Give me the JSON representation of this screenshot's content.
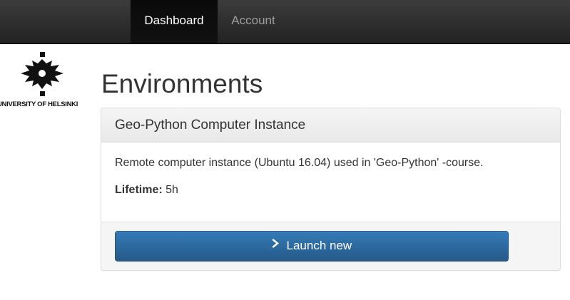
{
  "navbar": {
    "items": [
      {
        "label": "Dashboard",
        "active": true
      },
      {
        "label": "Account",
        "active": false
      }
    ]
  },
  "logo": {
    "text": "UNIVERSITY OF HELSINKI",
    "icon": "helsinki-torch-logo"
  },
  "page": {
    "title": "Environments"
  },
  "environment": {
    "name": "Geo-Python Computer Instance",
    "description": "Remote computer instance (Ubuntu 16.04) used in 'Geo-Python' -course.",
    "lifetime_label": "Lifetime:",
    "lifetime_value": "5h",
    "launch_label": "Launch new",
    "launch_icon": "chevron-right-icon"
  },
  "colors": {
    "navbar_bg": "#222222",
    "button_primary": "#337ab7",
    "panel_heading_bg": "#f5f5f5"
  }
}
